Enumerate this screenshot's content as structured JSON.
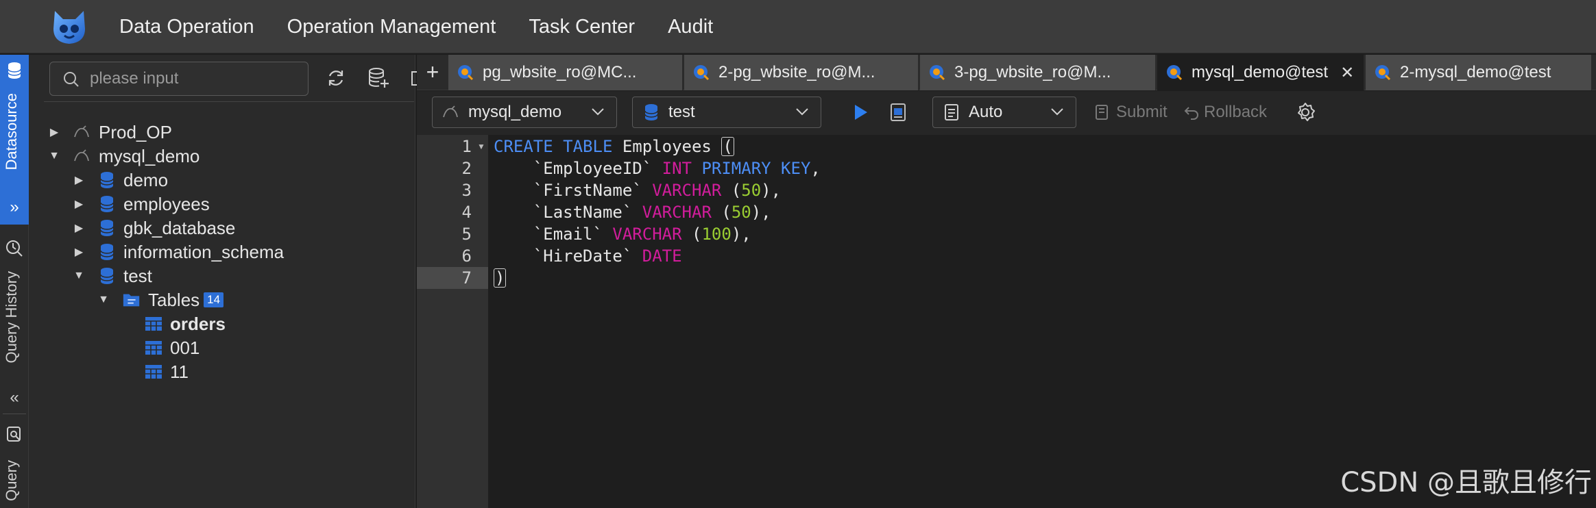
{
  "topnav": {
    "items": [
      "Data Operation",
      "Operation Management",
      "Task Center",
      "Audit"
    ]
  },
  "rail": {
    "datasource": "Datasource",
    "query_history": "Query History",
    "query": "Query"
  },
  "sidebar": {
    "search_placeholder": "please input",
    "tree": [
      {
        "label": "Prod_OP",
        "kind": "connection",
        "expanded": false
      },
      {
        "label": "mysql_demo",
        "kind": "connection",
        "expanded": true
      },
      {
        "label": "demo",
        "kind": "database",
        "expanded": false
      },
      {
        "label": "employees",
        "kind": "database",
        "expanded": false
      },
      {
        "label": "gbk_database",
        "kind": "database",
        "expanded": false
      },
      {
        "label": "information_schema",
        "kind": "database",
        "expanded": false
      },
      {
        "label": "test",
        "kind": "database",
        "expanded": true
      },
      {
        "label": "Tables",
        "kind": "folder",
        "expanded": true,
        "badge": "14"
      },
      {
        "label": "orders",
        "kind": "table"
      },
      {
        "label": "001",
        "kind": "table"
      },
      {
        "label": "11",
        "kind": "table"
      }
    ]
  },
  "tabs": [
    {
      "label": "pg_wbsite_ro@MC...",
      "active": false
    },
    {
      "label": "2-pg_wbsite_ro@M...",
      "active": false
    },
    {
      "label": "3-pg_wbsite_ro@M...",
      "active": false
    },
    {
      "label": "mysql_demo@test",
      "active": true
    },
    {
      "label": "2-mysql_demo@test",
      "active": false
    }
  ],
  "toolbar": {
    "connection": "mysql_demo",
    "database": "test",
    "mode": "Auto",
    "submit": "Submit",
    "rollback": "Rollback"
  },
  "editor": {
    "line_numbers": [
      "1",
      "2",
      "3",
      "4",
      "5",
      "6",
      "7"
    ],
    "current_line": 7,
    "lines": [
      "CREATE TABLE Employees (",
      "    `EmployeeID` INT PRIMARY KEY,",
      "    `FirstName` VARCHAR (50),",
      "    `LastName` VARCHAR (50),",
      "    `Email` VARCHAR (100),",
      "    `HireDate` DATE",
      ")"
    ]
  },
  "watermark": "CSDN @且歌且修行",
  "colors": {
    "accent": "#2d6fd6",
    "keyword": "#4d8ef5",
    "type": "#d21d9c",
    "number": "#9acd32"
  }
}
